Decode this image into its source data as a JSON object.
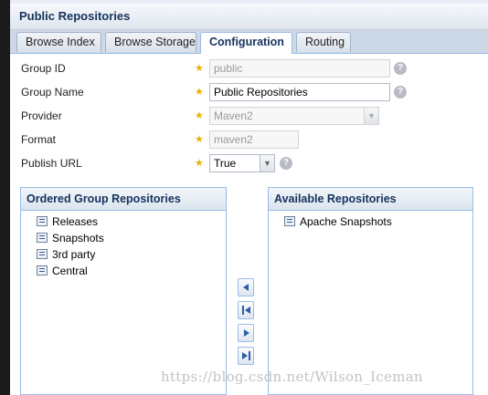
{
  "header": {
    "title": "Public Repositories"
  },
  "tabs": [
    {
      "label": "Browse Index",
      "active": false
    },
    {
      "label": "Browse Storage",
      "active": false
    },
    {
      "label": "Configuration",
      "active": true
    },
    {
      "label": "Routing",
      "active": false
    }
  ],
  "form": {
    "group_id": {
      "label": "Group ID",
      "value": "public",
      "disabled": true
    },
    "group_name": {
      "label": "Group Name",
      "value": "Public Repositories"
    },
    "provider": {
      "label": "Provider",
      "value": "Maven2",
      "disabled": true
    },
    "format": {
      "label": "Format",
      "value": "maven2",
      "disabled": true
    },
    "publish_url": {
      "label": "Publish URL",
      "value": "True"
    },
    "required_marker": "★",
    "help_glyph": "?"
  },
  "ordered_group": {
    "title": "Ordered Group Repositories",
    "items": [
      "Releases",
      "Snapshots",
      "3rd party",
      "Central"
    ]
  },
  "available": {
    "title": "Available Repositories",
    "items": [
      "Apache Snapshots"
    ]
  },
  "watermark": "https://blog.csdn.net/Wilson_Iceman",
  "colors": {
    "accent": "#15325c",
    "border": "#99bbe8",
    "star": "#e8b20f"
  }
}
